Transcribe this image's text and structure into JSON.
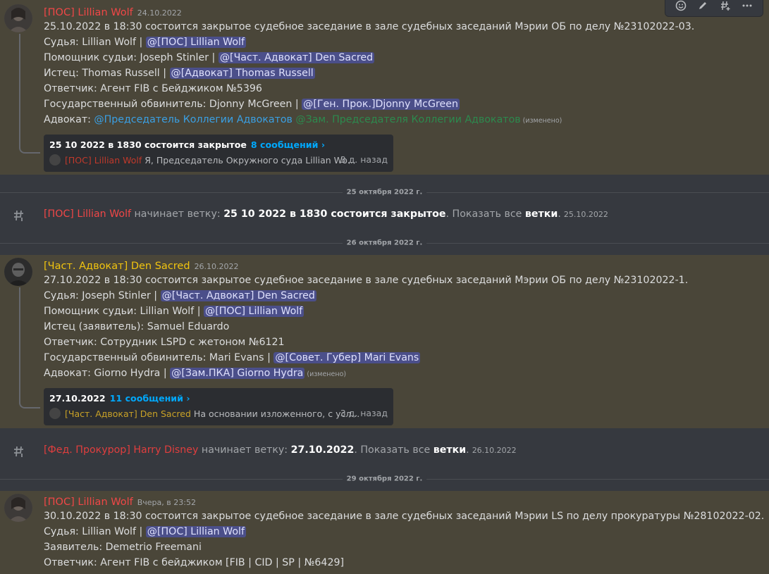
{
  "messages": [
    {
      "author": "[ПОС] Lillian Wolf",
      "author_color": "#f04747",
      "timestamp": "24.10.2022",
      "lines": [
        "25.10.2022 в 18:30 состоится закрытое судебное заседание в зале судебных заседаний Мэрии ОБ по делу №23102022-03.",
        "Судья: Lillian Wolf | ",
        "Помощник судьи: Joseph Stinler | ",
        "Истец: Thomas Russell | ",
        "Ответчик: Агент FIB с Бейджиком №5396",
        "Государственный обвинитель: Djonny McGreen | ",
        "Адвокат: "
      ],
      "mentions": {
        "judge": "@[ПОС] Lillian Wolf",
        "assistant": "@[Част. Адвокат] Den Sacred",
        "plaintiff": "@[Адвокат] Thomas Russell",
        "prosecutor": "@[Ген. Прок.]Djonny McGreen",
        "lawyer_role_1": "@Председатель Коллегии Адвокатов",
        "lawyer_role_2": "@Зам. Председателя Коллегии Адвокатов"
      },
      "edited": "(изменено)",
      "thread": {
        "title": "25 10 2022 в 1830 состоится закрытое",
        "count": "8 сообщений ›",
        "last_author": "[ПОС] Lillian Wolf",
        "last_text": "Я, Председатель Окружного суда Lillian Wo...",
        "ago": "3 д. назад"
      }
    },
    {
      "author": "[Част. Адвокат] Den Sacred",
      "author_color": "#f1c40f",
      "timestamp": "26.10.2022",
      "lines": [
        "27.10.2022 в 18:30 состоится закрытое судебное заседание в зале судебных заседаний Мэрии ОБ по делу №23102022-1.",
        "Судья: Joseph Stinler | ",
        "Помощник судьи: Lillian Wolf | ",
        "Истец (заявитель): Samuel Eduardo",
        "Ответчик: Сотрудник LSPD с жетоном №6121",
        "Государственный обвинитель: Mari Evans | ",
        "Адвокат: Giorno Hydra | "
      ],
      "mentions": {
        "judge": "@[Част. Адвокат] Den Sacred",
        "assistant": "@[ПОС] Lillian Wolf",
        "prosecutor": "@[Совет. Губер] Mari Evans",
        "lawyer": "@[Зам.ПКА] Giorno Hydra"
      },
      "edited": "(изменено)",
      "thread": {
        "title": "27.10.2022",
        "count": "11 сообщений ›",
        "last_author": "[Част. Адвокат] Den Sacred",
        "last_text": "На основании изложенного, с усл...",
        "ago": "3 д. назад"
      }
    },
    {
      "author": "[ПОС] Lillian Wolf",
      "author_color": "#f04747",
      "timestamp": "Вчера, в 23:52",
      "lines": [
        "30.10.2022 в 18:30 состоится закрытое судебное заседание в зале судебных заседаний Мэрии LS по делу прокуратуры №28102022-02.",
        "Судья: Lillian Wolf | ",
        "Заявитель: Demetrio Freemani",
        "Ответчик: Агент FIB с бейджиком [FIB | CID | SP | №6429]"
      ],
      "mentions": {
        "judge": "@[ПОС] Lillian Wolf"
      }
    }
  ],
  "dividers": [
    "25 октября 2022 г.",
    "26 октября 2022 г.",
    "29 октября 2022 г."
  ],
  "system_messages": [
    {
      "author": "[ПОС] Lillian Wolf",
      "author_color": "#f04747",
      "action": " начинает ветку: ",
      "thread_name": "25 10 2022 в 1830 состоится закрытое",
      "show_all": ". Показать все ",
      "threads_link": "ветки",
      "end": ".",
      "timestamp": "25.10.2022"
    },
    {
      "author": "[Фед. Прокурор] Harry Disney",
      "author_color": "#e03e3e",
      "action": " начинает ветку: ",
      "thread_name": "27.10.2022",
      "show_all": ". Показать все ",
      "threads_link": "ветки",
      "end": ".",
      "timestamp": "26.10.2022"
    }
  ],
  "icons": {
    "toolbar": [
      "emoji-reaction-icon",
      "edit-icon",
      "create-thread-icon",
      "more-icon"
    ],
    "system": "thread-hash-icon"
  },
  "colors": {
    "background": "#36393f",
    "highlight": "#4a4639",
    "mention_bg": "#4b4f8a",
    "link": "#00a8fc"
  }
}
